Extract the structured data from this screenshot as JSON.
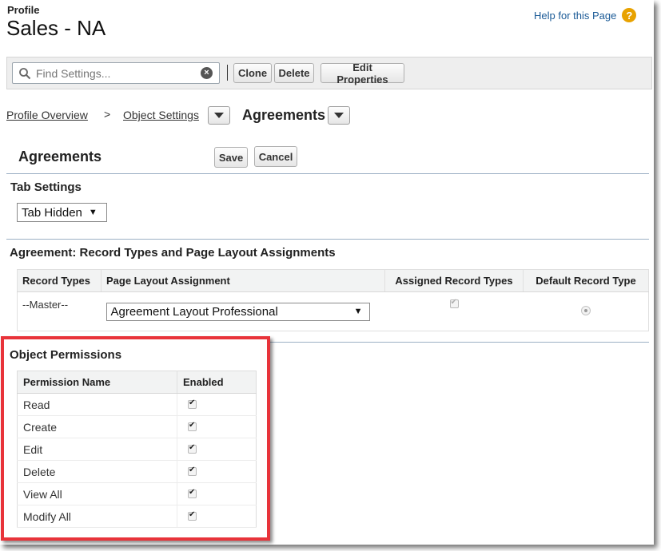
{
  "header": {
    "eyebrow": "Profile",
    "title": "Sales - NA",
    "help_link": "Help for this Page",
    "help_icon": "question-icon"
  },
  "toolbar": {
    "search_placeholder": "Find Settings...",
    "clone": "Clone",
    "delete": "Delete",
    "edit_properties": "Edit Properties"
  },
  "breadcrumb": {
    "overview": "Profile Overview",
    "separator": ">",
    "object_settings": "Object Settings",
    "current": "Agreements"
  },
  "edit": {
    "title": "Agreements",
    "save": "Save",
    "cancel": "Cancel"
  },
  "tab_settings": {
    "title": "Tab Settings",
    "value": "Tab Hidden"
  },
  "record_types": {
    "title": "Agreement: Record Types and Page Layout Assignments",
    "headers": [
      "Record Types",
      "Page Layout Assignment",
      "Assigned Record Types",
      "Default Record Type"
    ],
    "rows": [
      {
        "record_type": "--Master--",
        "layout": "Agreement Layout Professional",
        "assigned": true,
        "default": true
      }
    ]
  },
  "object_permissions": {
    "title": "Object Permissions",
    "headers": [
      "Permission Name",
      "Enabled"
    ],
    "rows": [
      {
        "name": "Read",
        "enabled": true
      },
      {
        "name": "Create",
        "enabled": true
      },
      {
        "name": "Edit",
        "enabled": true
      },
      {
        "name": "Delete",
        "enabled": true
      },
      {
        "name": "View All",
        "enabled": true
      },
      {
        "name": "Modify All",
        "enabled": true
      }
    ]
  },
  "colors": {
    "link": "#1a5a96",
    "highlight": "#e8333a",
    "help_icon": "#e8a200"
  }
}
